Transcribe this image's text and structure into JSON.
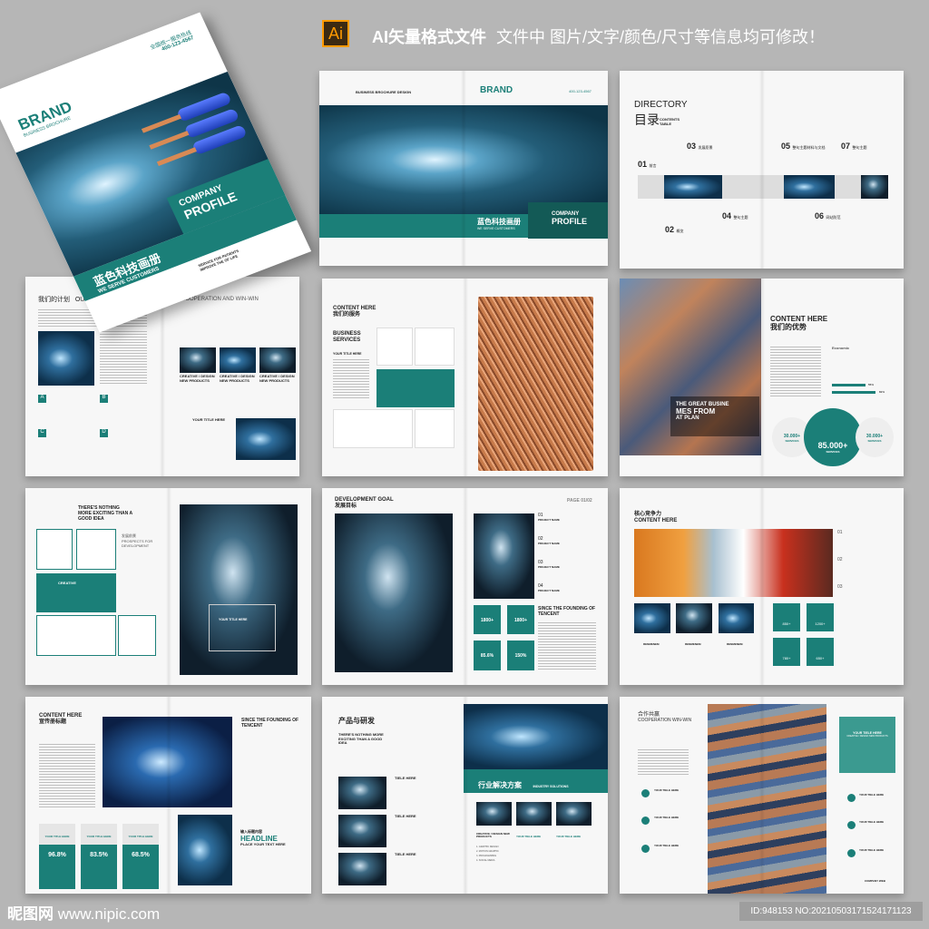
{
  "banner": {
    "badge": "Ai",
    "title": "AI矢量格式文件",
    "subtitle": "文件中 图片/文字/颜色/尺寸等信息均可修改！",
    "badge_color": "#3b2a12",
    "badge_text_color": "#ff9a00"
  },
  "cover": {
    "phone_label": "全国统一服务热线",
    "phone": "400-123-4567",
    "brand": "BRAND",
    "brand_sub": "BUSINESS BROCHURE",
    "company": "COMPANY",
    "profile": "PROFILE",
    "cn_title": "蓝色科技画册",
    "tagline": "WE SERVE CUSTOMERS",
    "service": "SERVICE FOR PATIENTS",
    "improve": "IMPROVE THE OF LIFE",
    "accent": "#1b7f78"
  },
  "spread_brochure": {
    "label": "BUSINESS BROCHURE DESIGN",
    "brand": "BRAND",
    "phone": "400-123-4567",
    "cn_title": "蓝色科技画册",
    "tagline": "WE SERVE CUSTOMERS",
    "company": "COMPANY",
    "profile": "PROFILE"
  },
  "directory": {
    "title": "DIRECTORY",
    "cn": "目录",
    "sub": "CONTENTS TABLE",
    "items": [
      {
        "num": "01",
        "label": "前言"
      },
      {
        "num": "02",
        "label": "概览"
      },
      {
        "num": "03",
        "label": "发展愿景"
      },
      {
        "num": "04",
        "label": "整句主题"
      },
      {
        "num": "05",
        "label": "整句主题材料与文档"
      },
      {
        "num": "06",
        "label": "网站防范"
      },
      {
        "num": "07",
        "label": "整句主题"
      }
    ]
  },
  "plans": {
    "cn": "我们的计划",
    "en": "OUR PLANS",
    "coop": "COOPERATION AND WIN-WIN",
    "cards": [
      "CREATIVE / DESIGN NEW PRODUCTS",
      "CREATIVE / DESIGN NEW PRODUCTS",
      "CREATIVE / DESIGN NEW PRODUCTS"
    ],
    "letters": [
      "A",
      "B",
      "C",
      "D"
    ],
    "your_title": "YOUR TITLE HERE"
  },
  "services": {
    "title": "CONTENT HERE",
    "cn": "我们的服务",
    "heading": "BUSINESS SERVICES",
    "your_title": "YOUR TITLE HERE"
  },
  "advantage": {
    "title": "CONTENT HERE",
    "cn": "我们的优势",
    "economic": "Economic",
    "bar1": "55%",
    "bar2": "82%",
    "bar1_value": 0.55,
    "bar2_value": 0.82,
    "stat_left": "30.000+",
    "stat_main": "85.000+",
    "stat_right": "30.000+",
    "stat_label": "SERVICES",
    "quote": [
      "THE GREAT BUSINE",
      "MES FROM",
      "AT PLAN"
    ]
  },
  "creative": {
    "heading": "THERE'S NOTHING MORE EXCITING THAN A GOOD IDEA",
    "prospects_cn": "发展前景",
    "prospects": "PROSPECTS FOR DEVELOPMENT",
    "card": "CREATIVE",
    "your_title": "YOUR TITLE HERE"
  },
  "development": {
    "title": "DEVELOPMENT GOAL",
    "cn": "发展目标",
    "page": "PAGE 01/02",
    "items": [
      "01",
      "02",
      "03",
      "04"
    ],
    "project": "PROJECT NAME",
    "since": "SINCE THE FOUNDING OF TENCENT",
    "stats": [
      "1800+",
      "1800+",
      "85.6%",
      "150%"
    ]
  },
  "core": {
    "cn": "核心竞争力",
    "title": "CONTENT HERE",
    "items": [
      "01",
      "02",
      "03"
    ],
    "label": "RENMENEM",
    "stats": [
      "850+",
      "1200+",
      "780+",
      "650+"
    ]
  },
  "content4": {
    "title": "CONTENT HERE",
    "cn": "宣传册标题",
    "since": "SINCE THE FOUNDING OF TENCENT",
    "stats": [
      "96.8%",
      "83.5%",
      "68.5%"
    ],
    "your_title": "YOUR TITLE HERE",
    "cn_head": "输入标题内容",
    "headline": "HEADLINE",
    "place": "PLACE YOUR TEXT HERE"
  },
  "product": {
    "cn": "产品与研发",
    "heading": "THERE'S NOTHING MORE EXCITING THAN A GOOD IDEA",
    "tiles": [
      "TIELE HERE",
      "TIELE HERE",
      "TIELE HERE"
    ],
    "industry_cn": "行业解决方案",
    "industry": "INDUSTRY SOLUTIONS",
    "creative": "CREATIVE / DESIGN NEW PRODUCTS",
    "list": [
      "1. GRAPHIC DESIGN",
      "2. MOTION GRAPHIC",
      "3. PROGRAMMING",
      "4. SOCIAL MEDIA"
    ],
    "your_title": "YOUR TIELE HERE"
  },
  "coop": {
    "cn": "合作共赢",
    "en": "COOPERATION WIN-WIN",
    "your_title": "YOUR TIELE HERE",
    "creative": "CREATIVE / DESIGN NEW PRODUCTS",
    "web": "COMPANY WEB"
  },
  "watermark": {
    "site_cn": "昵图网",
    "site": "www.nipic.com",
    "id": "ID:948153 NO:20210503171524171123"
  }
}
